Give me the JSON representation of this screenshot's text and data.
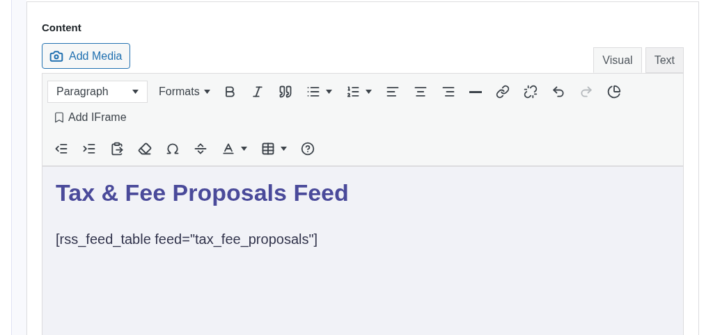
{
  "field_label": "Content",
  "add_media_button": "Add Media",
  "tabs": [
    {
      "label": "Visual",
      "selected": true
    },
    {
      "label": "Text",
      "selected": false
    }
  ],
  "toolbar_rows": [
    [
      {
        "kind": "select",
        "label": "Paragraph"
      },
      {
        "kind": "menu",
        "label": "Formats"
      },
      {
        "kind": "icon",
        "disabled": false,
        "dropdown": false
      },
      {
        "kind": "icon",
        "disabled": false,
        "dropdown": false
      },
      {
        "kind": "icon",
        "disabled": false,
        "dropdown": false
      },
      {
        "kind": "icon",
        "disabled": false,
        "dropdown": true
      },
      {
        "kind": "icon",
        "disabled": false,
        "dropdown": true
      },
      {
        "kind": "icon",
        "disabled": false,
        "dropdown": false
      },
      {
        "kind": "icon",
        "disabled": false,
        "dropdown": false
      },
      {
        "kind": "icon",
        "disabled": false,
        "dropdown": false
      },
      {
        "kind": "icon",
        "disabled": false,
        "dropdown": false
      },
      {
        "kind": "icon",
        "disabled": false,
        "dropdown": false
      },
      {
        "kind": "icon",
        "disabled": false,
        "dropdown": false
      },
      {
        "kind": "icon",
        "disabled": false,
        "dropdown": false
      },
      {
        "kind": "icon",
        "disabled": true,
        "dropdown": false
      },
      {
        "kind": "icon",
        "disabled": false,
        "dropdown": false
      }
    ],
    [
      {
        "kind": "labeled",
        "label": "Add IFrame"
      }
    ],
    [
      {
        "kind": "icon",
        "disabled": false,
        "dropdown": false
      },
      {
        "kind": "icon",
        "disabled": false,
        "dropdown": false
      },
      {
        "kind": "icon",
        "disabled": false,
        "dropdown": false
      },
      {
        "kind": "icon",
        "disabled": false,
        "dropdown": false
      },
      {
        "kind": "icon",
        "disabled": false,
        "dropdown": false
      },
      {
        "kind": "icon",
        "disabled": false,
        "dropdown": false
      },
      {
        "kind": "icon",
        "disabled": false,
        "dropdown": true
      },
      {
        "kind": "icon",
        "disabled": false,
        "dropdown": true
      },
      {
        "kind": "icon",
        "disabled": false,
        "dropdown": false
      }
    ]
  ],
  "editor": {
    "heading": "Tax & Fee Proposals Feed",
    "paragraph": "[rss_feed_table feed=\"tax_fee_proposals\"]"
  }
}
